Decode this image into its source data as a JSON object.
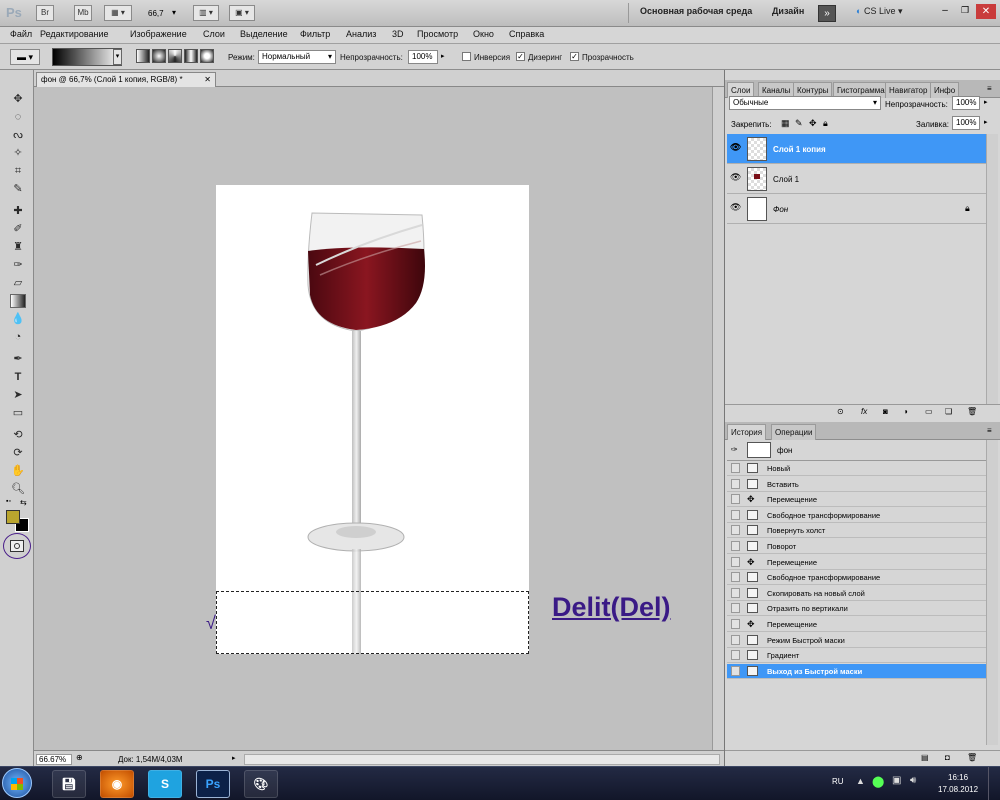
{
  "appbar": {
    "logo": "Ps",
    "br_label": "Br",
    "mb_label": "Mb",
    "zoom": "66,7",
    "workspace_label": "Основная рабочая среда",
    "design_label": "Дизайн",
    "cslive_label": "CS Live"
  },
  "menu": {
    "items": [
      "Файл",
      "Редактирование",
      "Изображение",
      "Слои",
      "Выделение",
      "Фильтр",
      "Анализ",
      "3D",
      "Просмотр",
      "Окно",
      "Справка"
    ]
  },
  "options": {
    "mode_label": "Режим:",
    "mode_value": "Нормальный",
    "opacity_label": "Непрозрачность:",
    "opacity_value": "100%",
    "inverse_label": "Инверсия",
    "dither_label": "Дизеринг",
    "transparency_label": "Прозрачность"
  },
  "document": {
    "tab_title": "фон @ 66,7% (Слой 1 копия, RGB/8) *",
    "zoom_status": "66.67%",
    "doc_size": "Док: 1,54M/4,03M",
    "annotation": "Delit(Del)",
    "accent_color": "#3a1a86"
  },
  "layers_panel": {
    "tabs": [
      "Слои",
      "Каналы",
      "Контуры",
      "Гистограмма",
      "Навигатор",
      "Инфо"
    ],
    "blend_mode": "Обычные",
    "opacity_label": "Непрозрачность:",
    "opacity_value": "100%",
    "lock_label": "Закрепить:",
    "fill_label": "Заливка:",
    "fill_value": "100%",
    "layers": [
      {
        "name": "Слой 1 копия",
        "selected": true
      },
      {
        "name": "Слой 1",
        "selected": false
      },
      {
        "name": "Фон",
        "selected": false
      }
    ]
  },
  "history_panel": {
    "tabs": [
      "История",
      "Операции"
    ],
    "snapshot": "фон",
    "items": [
      "Новый",
      "Вставить",
      "Перемещение",
      "Свободное трансформирование",
      "Повернуть холст",
      "Поворот",
      "Перемещение",
      "Свободное трансформирование",
      "Скопировать на новый слой",
      "Отразить по вертикали",
      "Перемещение",
      "Режим Быстрой маски",
      "Градиент",
      "Выход из Быстрой маски"
    ],
    "selected_index": 13
  },
  "taskbar": {
    "lang": "RU",
    "time": "16:16",
    "date": "17.08.2012"
  },
  "colors": {
    "selection_blue": "#3f97f6",
    "foreground_swatch": "#b9a52e",
    "background_swatch": "#000000",
    "wine": "#7a0f18"
  }
}
